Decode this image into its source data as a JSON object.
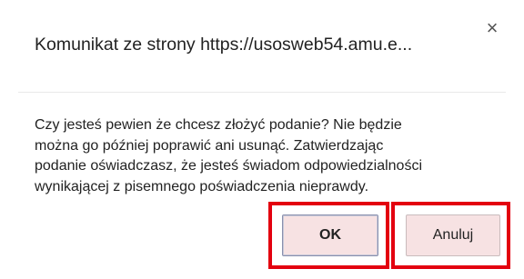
{
  "dialog": {
    "title": "Komunikat ze strony https://usosweb54.amu.e...",
    "close_icon": "close-icon",
    "close_glyph": "×",
    "message_lines": [
      "Czy jesteś pewien że chcesz złożyć podanie? Nie będzie",
      "można go później poprawić ani usunąć. Zatwierdzając",
      "podanie oświadczasz, że jesteś świadom odpowiedzialności",
      "wynikającej z pisemnego poświadczenia nieprawdy."
    ],
    "ok_label": "OK",
    "cancel_label": "Anuluj",
    "highlight_color": "#e3000f",
    "button_bg_color": "#f7e2e3"
  }
}
